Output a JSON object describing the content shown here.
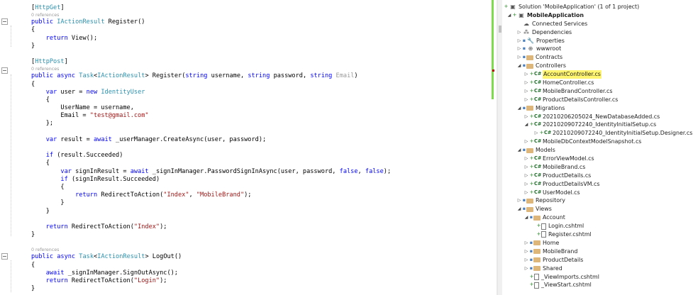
{
  "code": {
    "references_0": "0 references",
    "http_get": "[HttpGet]",
    "http_post": "[HttpPost]",
    "email_literal": "\"test@gmail.com\"",
    "index_literal": "\"Index\"",
    "mobilebrand_literal": "\"MobileBrand\"",
    "login_literal": "\"Login\""
  },
  "solution": {
    "title": "Solution 'MobileApplication' (1 of 1 project)",
    "project": "MobileApplication",
    "items": {
      "connected_services": "Connected Services",
      "dependencies": "Dependencies",
      "properties": "Properties",
      "wwwroot": "wwwroot",
      "contracts": "Contracts",
      "controllers": "Controllers",
      "account_controller": "AccountController.cs",
      "home_controller": "HomeController.cs",
      "mobilebrand_controller": "MobileBrandController.cs",
      "productdetails_controller": "ProductDetailsController.cs",
      "migrations": "Migrations",
      "mig1": "20210206205024_NewDatabaseAdded.cs",
      "mig2": "20210209072240_IdentityInitialSetup.cs",
      "mig2_designer": "20210209072240_IdentityInitialSetup.Designer.cs",
      "snapshot": "MobileDbContextModelSnapshot.cs",
      "models": "Models",
      "errorviewmodel": "ErrorViewModel.cs",
      "mobilebrand": "MobileBrand.cs",
      "productdetails": "ProductDetails.cs",
      "productdetailsvm": "ProductDetailsVM.cs",
      "usermodel": "UserModel.cs",
      "repository": "Repository",
      "views": "Views",
      "account": "Account",
      "login_view": "Login.cshtml",
      "register_view": "Register.cshtml",
      "home": "Home",
      "mobilebrand_folder": "MobileBrand",
      "productdetails_folder": "ProductDetails",
      "shared": "Shared",
      "viewimports": "_ViewImports.cshtml",
      "viewstart": "_ViewStart.cshtml"
    }
  },
  "colors": {
    "highlight": "#fff570",
    "keyword": "#0000ff",
    "type": "#2b91af",
    "string": "#a31515"
  }
}
